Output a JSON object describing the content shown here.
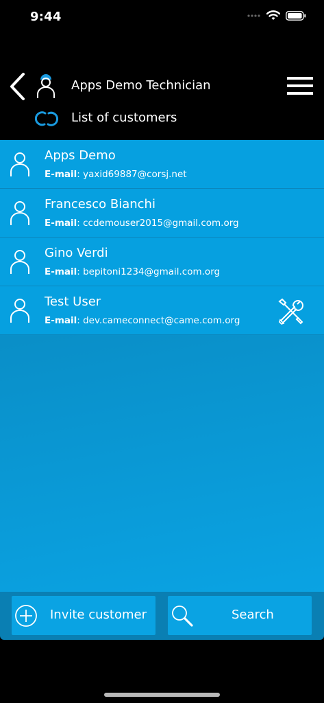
{
  "status": {
    "time": "9:44"
  },
  "header": {
    "technician_name": "Apps Demo Technician",
    "subtitle": "List of customers"
  },
  "colors": {
    "accent": "#06a0e0",
    "icon_blue": "#1a9be0",
    "background": "#000000"
  },
  "customers": [
    {
      "name": "Apps Demo",
      "email_label": "E-mail",
      "email": "yaxid69887@corsj.net",
      "has_tools": false
    },
    {
      "name": "Francesco Bianchi",
      "email_label": "E-mail",
      "email": "ccdemouser2015@gmail.com.org",
      "has_tools": false
    },
    {
      "name": "Gino Verdi",
      "email_label": "E-mail",
      "email": "bepitoni1234@gmail.com.org",
      "has_tools": false
    },
    {
      "name": "Test User",
      "email_label": "E-mail",
      "email": "dev.cameconnect@came.com.org",
      "has_tools": true
    }
  ],
  "actions": {
    "invite_label": "Invite customer",
    "search_label": "Search"
  },
  "icons": {
    "back": "chevron-left-icon",
    "technician": "technician-icon",
    "menu": "hamburger-menu-icon",
    "link": "link-icon",
    "avatar": "user-icon",
    "tools": "tools-icon",
    "invite": "plus-circle-icon",
    "search": "magnifier-icon"
  }
}
